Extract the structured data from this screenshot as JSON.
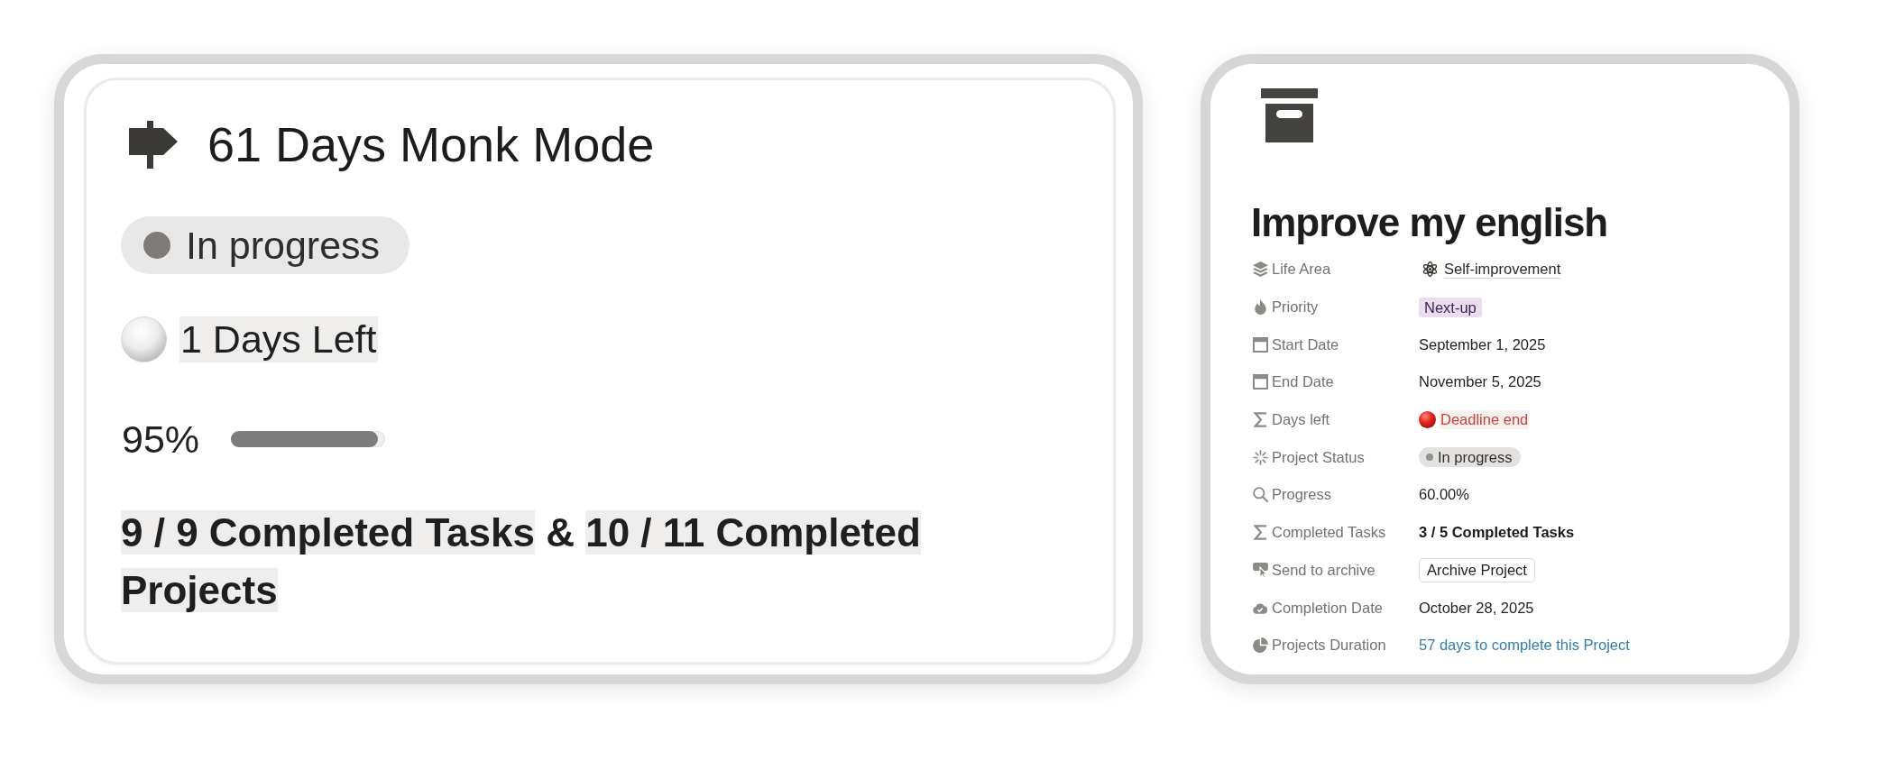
{
  "project_card": {
    "title": "61 Days Monk Mode",
    "status": "In progress",
    "days_left": {
      "text": "1 Days Left",
      "highlighted": true
    },
    "progress": {
      "reading": "95%",
      "level": 0.95
    },
    "summary": [
      {
        "text": "9 / 9 Completed Tasks",
        "highlighted": true
      },
      {
        "text": "&",
        "highlighted": false
      },
      {
        "text": "10 / 11 Completed Projects",
        "highlighted": true
      }
    ]
  },
  "project_page": {
    "title": "Improve my english",
    "properties": [
      {
        "label": "Life Area",
        "kind": "relation",
        "value": "Self-improvement"
      },
      {
        "label": "Priority",
        "kind": "tag",
        "value": "Next-up"
      },
      {
        "label": "Start Date",
        "kind": "text",
        "value": "September 1, 2025"
      },
      {
        "label": "End Date",
        "kind": "text",
        "value": "November 5, 2025"
      },
      {
        "label": "Days left",
        "kind": "alert",
        "value": "Deadline end"
      },
      {
        "label": "Project Status",
        "kind": "status",
        "value": "In progress"
      },
      {
        "label": "Progress",
        "kind": "text",
        "value": "60.00%"
      },
      {
        "label": "Completed Tasks",
        "kind": "bold",
        "value": "3 / 5 Completed Tasks"
      },
      {
        "label": "Send to archive",
        "kind": "button",
        "value": "Archive Project"
      },
      {
        "label": "Completion Date",
        "kind": "text",
        "value": "October 28, 2025"
      },
      {
        "label": "Projects Duration",
        "kind": "accent",
        "value": "57 days to complete this Project"
      }
    ]
  }
}
